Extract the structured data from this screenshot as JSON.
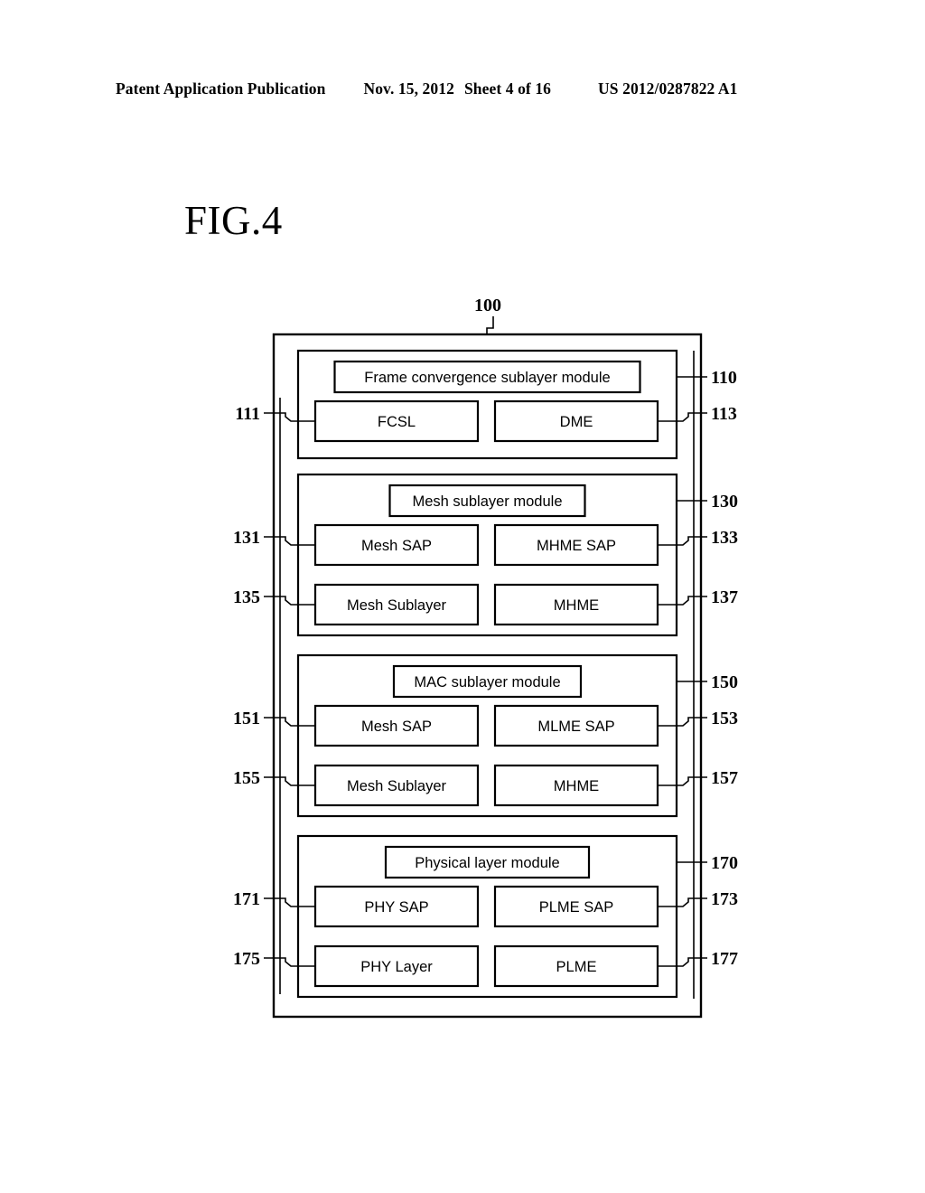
{
  "header": {
    "publication": "Patent Application Publication",
    "date": "Nov. 15, 2012",
    "sheet": "Sheet 4 of 16",
    "document_number": "US 2012/0287822 A1"
  },
  "figure": {
    "label": "FIG.4",
    "system_ref": "100"
  },
  "modules": [
    {
      "title": "Frame convergence sublayer module",
      "ref_right": "110",
      "rows": [
        {
          "left": {
            "label": "FCSL",
            "ref": "111",
            "ref_side": "left"
          },
          "right": {
            "label": "DME",
            "ref": "113",
            "ref_side": "right"
          }
        }
      ]
    },
    {
      "title": "Mesh sublayer module",
      "ref_right": "130",
      "rows": [
        {
          "left": {
            "label": "Mesh SAP",
            "ref": "131",
            "ref_side": "left"
          },
          "right": {
            "label": "MHME SAP",
            "ref": "133",
            "ref_side": "right"
          }
        },
        {
          "left": {
            "label": "Mesh Sublayer",
            "ref": "135",
            "ref_side": "left"
          },
          "right": {
            "label": "MHME",
            "ref": "137",
            "ref_side": "right"
          }
        }
      ]
    },
    {
      "title": "MAC sublayer module",
      "ref_right": "150",
      "rows": [
        {
          "left": {
            "label": "Mesh SAP",
            "ref": "151",
            "ref_side": "left"
          },
          "right": {
            "label": "MLME SAP",
            "ref": "153",
            "ref_side": "right"
          }
        },
        {
          "left": {
            "label": "Mesh Sublayer",
            "ref": "155",
            "ref_side": "left"
          },
          "right": {
            "label": "MHME",
            "ref": "157",
            "ref_side": "right"
          }
        }
      ]
    },
    {
      "title": "Physical layer module",
      "ref_right": "170",
      "rows": [
        {
          "left": {
            "label": "PHY SAP",
            "ref": "171",
            "ref_side": "left"
          },
          "right": {
            "label": "PLME SAP",
            "ref": "173",
            "ref_side": "right"
          }
        },
        {
          "left": {
            "label": "PHY Layer",
            "ref": "175",
            "ref_side": "left"
          },
          "right": {
            "label": "PLME",
            "ref": "177",
            "ref_side": "right"
          }
        }
      ]
    }
  ],
  "colors": {
    "ink": "#000000",
    "paper": "#ffffff"
  }
}
